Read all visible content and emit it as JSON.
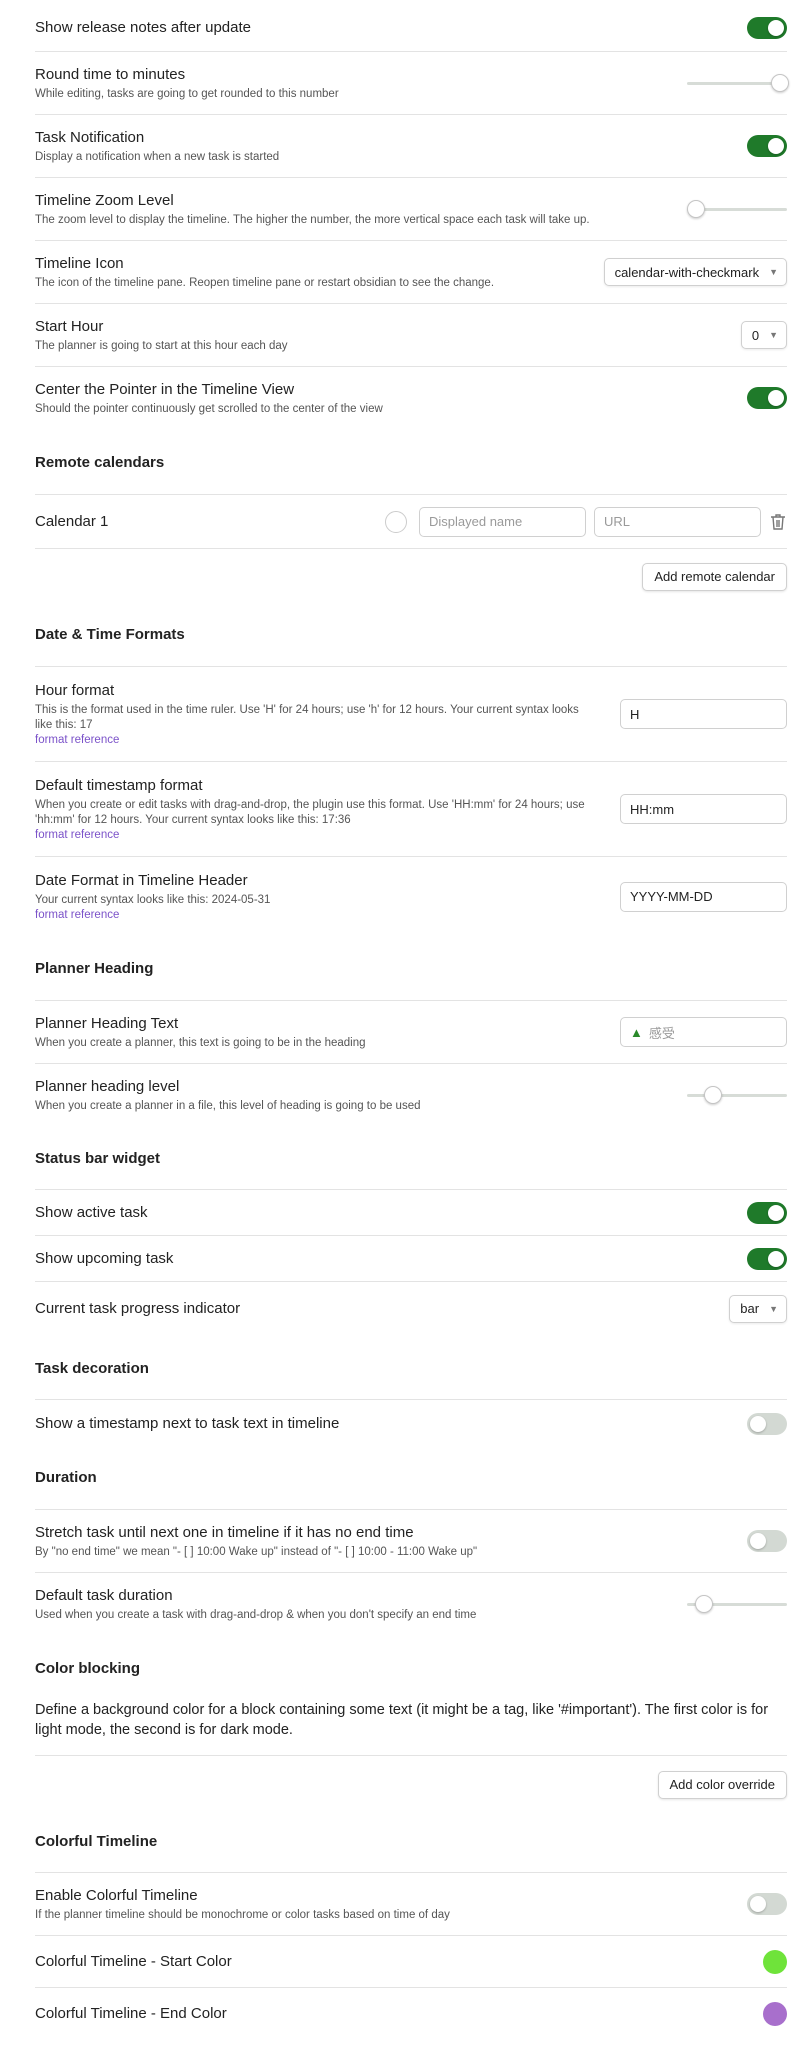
{
  "settings": {
    "release_notes": {
      "name": "Show release notes after update",
      "on": true
    },
    "round_time": {
      "name": "Round time to minutes",
      "desc": "While editing, tasks are going to get rounded to this number",
      "level": 1.0
    },
    "task_notification": {
      "name": "Task Notification",
      "desc": "Display a notification when a new task is started",
      "on": true
    },
    "zoom_level": {
      "name": "Timeline Zoom Level",
      "desc": "The zoom level to display the timeline. The higher the number, the more vertical space each task will take up.",
      "level": 0.0
    },
    "timeline_icon": {
      "name": "Timeline Icon",
      "desc": "The icon of the timeline pane. Reopen timeline pane or restart obsidian to see the change.",
      "value": "calendar-with-checkmark"
    },
    "start_hour": {
      "name": "Start Hour",
      "desc": "The planner is going to start at this hour each day",
      "value": "0"
    },
    "center_pointer": {
      "name": "Center the Pointer in the Timeline View",
      "desc": "Should the pointer continuously get scrolled to the center of the view",
      "on": true
    }
  },
  "remote": {
    "heading": "Remote calendars",
    "calendar_name": "Calendar 1",
    "name_placeholder": "Displayed name",
    "url_placeholder": "URL",
    "add_label": "Add remote calendar"
  },
  "datetime": {
    "heading": "Date & Time Formats",
    "hour": {
      "name": "Hour format",
      "desc": "This is the format used in the time ruler. Use 'H' for 24 hours; use 'h' for 12 hours. Your current syntax looks like this: 17",
      "link": "format reference",
      "value": "H"
    },
    "timestamp": {
      "name": "Default timestamp format",
      "desc": "When you create or edit tasks with drag-and-drop, the plugin use this format. Use 'HH:mm' for 24 hours; use 'hh:mm' for 12 hours. Your current syntax looks like this: 17:36",
      "link": "format reference",
      "value": "HH:mm"
    },
    "date_header": {
      "name": "Date Format in Timeline Header",
      "desc": "Your current syntax looks like this: 2024-05-31",
      "link": "format reference",
      "value": "YYYY-MM-DD"
    }
  },
  "planner": {
    "heading": "Planner Heading",
    "text": {
      "name": "Planner Heading Text",
      "desc": "When you create a planner, this text is going to be in the heading",
      "placeholder": "感受"
    },
    "level": {
      "name": "Planner heading level",
      "desc": "When you create a planner in a file, this level of heading is going to be used",
      "level": 0.25
    }
  },
  "statusbar": {
    "heading": "Status bar widget",
    "active": {
      "name": "Show active task",
      "on": true
    },
    "upcoming": {
      "name": "Show upcoming task",
      "on": true
    },
    "progress": {
      "name": "Current task progress indicator",
      "value": "bar"
    }
  },
  "decoration": {
    "heading": "Task decoration",
    "timestamp": {
      "name": "Show a timestamp next to task text in timeline",
      "on": false
    }
  },
  "duration": {
    "heading": "Duration",
    "stretch": {
      "name": "Stretch task until next one in timeline if it has no end time",
      "desc": "By \"no end time\" we mean \"- [ ] 10:00 Wake up\" instead of \"- [ ] 10:00 - 11:00 Wake up\"",
      "on": false
    },
    "default": {
      "name": "Default task duration",
      "desc": "Used when you create a task with drag-and-drop & when you don't specify an end time",
      "level": 0.15
    }
  },
  "color_blocking": {
    "heading": "Color blocking",
    "text": "Define a background color for a block containing some text (it might be a tag, like '#important'). The first color is for light mode, the second is for dark mode.",
    "add_label": "Add color override"
  },
  "colorful": {
    "heading": "Colorful Timeline",
    "enable": {
      "name": "Enable Colorful Timeline",
      "desc": "If the planner timeline should be monochrome or color tasks based on time of day",
      "on": false
    },
    "start": {
      "name": "Colorful Timeline - Start Color",
      "color": "#6fe33a"
    },
    "end": {
      "name": "Colorful Timeline - End Color",
      "color": "#a86fcc"
    }
  },
  "colors": {
    "toggle_on": "#1f7a2a",
    "toggle_off": "#d3d9d3",
    "link": "#7b52c9"
  }
}
